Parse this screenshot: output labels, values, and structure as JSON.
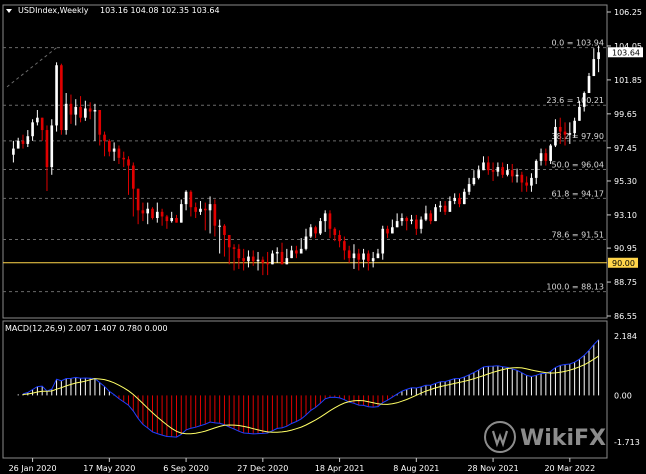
{
  "header": {
    "symbol_label": "USDIndex,Weekly",
    "ohlc": "103.16 104.08 102.35 103.64"
  },
  "macd": {
    "label": "MACD(12,26,9) 2.007 1.407 0.780 0.000",
    "axis_labels": [
      "2.184",
      "0.00",
      "-1.713"
    ],
    "ylim": [
      -1.713,
      2.184
    ]
  },
  "price_axis": {
    "labels": [
      "106.25",
      "104.05",
      "101.85",
      "99.65",
      "97.45",
      "95.30",
      "93.10",
      "90.95",
      "88.75",
      "86.55"
    ],
    "ylim": [
      86.55,
      106.25
    ],
    "current_price": "103.64",
    "horizontal_line_price": "90.00"
  },
  "fib_levels": [
    {
      "label": "0.0 = 103.94",
      "price": 103.94
    },
    {
      "label": "23.6 = 100.21",
      "price": 100.21
    },
    {
      "label": "38.2 = 97.90",
      "price": 97.9
    },
    {
      "label": "50.0 = 96.04",
      "price": 96.04
    },
    {
      "label": "61.8 = 94.17",
      "price": 94.17
    },
    {
      "label": "78.6 = 91.51",
      "price": 91.51
    },
    {
      "label": "100.0 = 88.13",
      "price": 88.13
    }
  ],
  "time_axis": {
    "labels": [
      "26 Jan 2020",
      "17 May 2020",
      "6 Sep 2020",
      "27 Dec 2020",
      "18 Apr 2021",
      "8 Aug 2021",
      "28 Nov 2021",
      "20 Mar 2022"
    ]
  },
  "watermark": {
    "text": "WikiFX",
    "icon": "wikifx-logo-icon"
  },
  "colors": {
    "background": "#000000",
    "bull": "#ffffff",
    "bear": "#e00000",
    "grid": "#6a6a6a",
    "macd_line": "#1f3fff",
    "signal_line": "#ffff66",
    "hline": "#ffd54a"
  },
  "chart_data": {
    "type": "candlestick",
    "series": [
      {
        "name": "USDIndex,Weekly",
        "x_start": "2019-12-29",
        "x_step_days": 7,
        "close": [
          97.4,
          97.9,
          97.7,
          98.2,
          99.1,
          99.4,
          98.6,
          96.2,
          98.9,
          102.8,
          98.6,
          100.3,
          99.6,
          100.1,
          99.4,
          100.0,
          99.8,
          99.9,
          98.3,
          97.9,
          97.2,
          97.4,
          96.8,
          96.7,
          96.3,
          94.8,
          93.4,
          93.2,
          93.5,
          92.9,
          93.3,
          93.0,
          92.7,
          92.9,
          92.6,
          93.8,
          94.6,
          93.6,
          93.3,
          93.5,
          93.4,
          93.8,
          92.4,
          92.4,
          91.8,
          91.0,
          90.9,
          90.3,
          90.1,
          90.4,
          90.1,
          90.2,
          90.0,
          89.9,
          90.6,
          90.7,
          89.9,
          90.3,
          90.8,
          90.6,
          90.9,
          91.7,
          92.3,
          91.9,
          92.7,
          93.2,
          92.2,
          91.8,
          91.4,
          90.8,
          90.3,
          90.6,
          90.2,
          90.6,
          90.1,
          90.3,
          90.6,
          92.2,
          91.9,
          92.3,
          92.7,
          92.9,
          92.7,
          92.8,
          92.2,
          92.8,
          93.2,
          92.7,
          93.6,
          93.7,
          93.3,
          94.0,
          94.2,
          93.8,
          94.6,
          95.1,
          95.5,
          96.0,
          96.5,
          96.0,
          95.9,
          96.2,
          95.7,
          96.0,
          95.6,
          95.7,
          95.2,
          95.0,
          95.5,
          96.6,
          97.1,
          96.6,
          97.6,
          98.8,
          98.5,
          98.3,
          98.4,
          99.2,
          100.1,
          101.0,
          102.1,
          103.2,
          103.64
        ],
        "high": [
          97.9,
          98.1,
          98.3,
          98.6,
          99.3,
          99.9,
          99.0,
          98.9,
          99.3,
          102.99,
          102.9,
          101.0,
          100.9,
          100.6,
          100.8,
          100.5,
          100.4,
          100.3,
          99.3,
          98.5,
          98.0,
          97.8,
          97.6,
          97.2,
          96.9,
          96.5,
          94.7,
          93.9,
          93.9,
          93.6,
          93.9,
          93.5,
          93.1,
          93.3,
          93.1,
          94.1,
          94.7,
          94.7,
          93.9,
          94.0,
          93.9,
          94.3,
          94.1,
          92.8,
          92.5,
          91.8,
          91.2,
          91.2,
          90.9,
          90.8,
          90.8,
          90.7,
          90.4,
          90.7,
          90.8,
          91.0,
          91.3,
          90.9,
          91.1,
          91.1,
          91.6,
          92.2,
          92.5,
          92.4,
          92.9,
          93.4,
          93.4,
          92.3,
          92.1,
          91.7,
          91.1,
          91.2,
          90.9,
          90.9,
          90.8,
          90.7,
          90.9,
          92.4,
          92.4,
          92.8,
          93.2,
          93.2,
          93.0,
          93.1,
          93.1,
          93.0,
          93.7,
          93.4,
          93.8,
          94.0,
          94.0,
          94.3,
          94.5,
          94.5,
          94.8,
          95.5,
          96.0,
          96.3,
          96.9,
          96.9,
          96.5,
          96.5,
          96.5,
          96.4,
          96.4,
          96.1,
          95.9,
          95.6,
          95.8,
          96.7,
          97.4,
          97.4,
          97.7,
          99.3,
          99.4,
          99.1,
          99.1,
          99.4,
          100.5,
          101.1,
          102.3,
          103.9,
          104.08
        ],
        "low": [
          96.5,
          97.4,
          97.4,
          97.5,
          97.9,
          98.9,
          97.9,
          94.65,
          95.7,
          98.5,
          98.3,
          98.3,
          99.0,
          98.9,
          99.1,
          99.2,
          99.3,
          97.9,
          97.6,
          96.9,
          96.9,
          96.6,
          96.4,
          96.2,
          94.4,
          93.0,
          92.5,
          92.7,
          92.5,
          92.8,
          92.6,
          92.4,
          92.2,
          92.6,
          92.6,
          93.0,
          93.4,
          93.0,
          92.9,
          93.1,
          92.1,
          91.9,
          91.7,
          90.6,
          90.4,
          89.9,
          89.5,
          89.6,
          89.5,
          89.7,
          89.8,
          89.5,
          89.2,
          89.2,
          90.3,
          90.0,
          89.9,
          90.1,
          90.4,
          90.3,
          90.6,
          90.8,
          91.6,
          91.6,
          91.8,
          92.0,
          91.6,
          91.4,
          91.0,
          90.2,
          90.0,
          89.6,
          89.5,
          89.7,
          89.5,
          89.7,
          90.3,
          90.2,
          91.6,
          91.9,
          92.3,
          92.4,
          92.1,
          92.5,
          91.8,
          91.9,
          92.7,
          92.5,
          92.7,
          93.3,
          93.1,
          93.4,
          93.8,
          93.6,
          93.8,
          94.4,
          95.0,
          95.4,
          96.0,
          95.7,
          95.3,
          95.6,
          95.5,
          95.6,
          95.2,
          95.2,
          94.6,
          94.6,
          94.6,
          95.1,
          96.3,
          96.3,
          96.4,
          97.5,
          97.7,
          97.6,
          97.7,
          98.1,
          99.3,
          99.8,
          101.0,
          102.1,
          102.35
        ]
      }
    ]
  }
}
